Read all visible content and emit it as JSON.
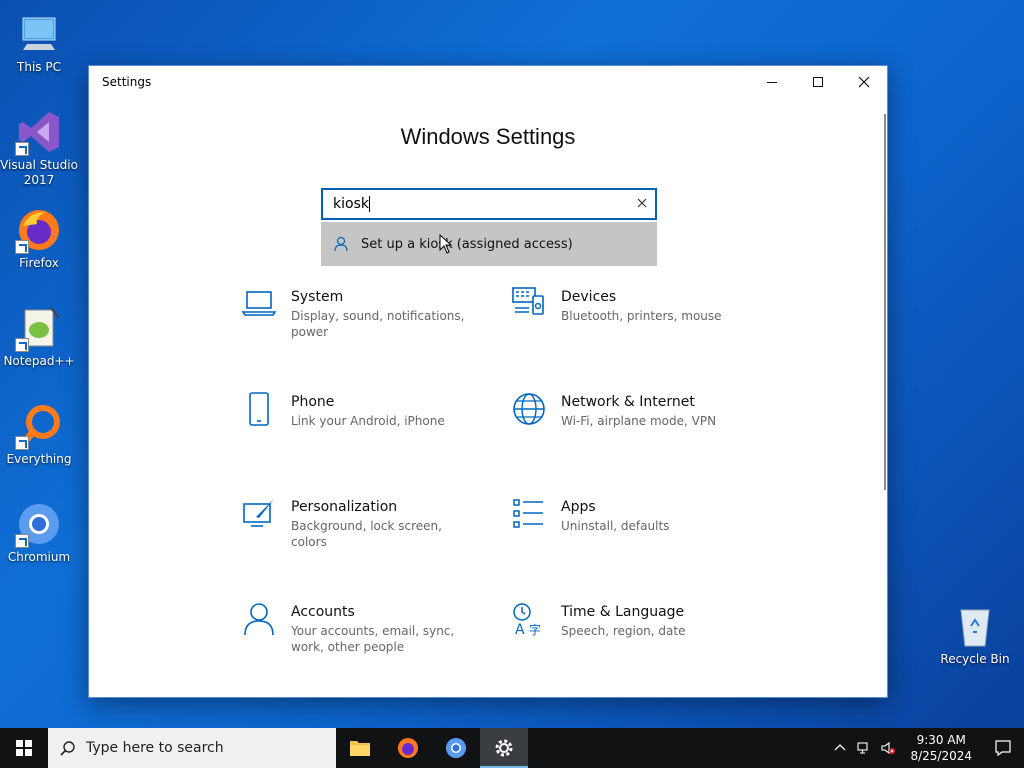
{
  "desktop": {
    "icons": [
      {
        "label": "This PC"
      },
      {
        "label": "Visual Studio 2017"
      },
      {
        "label": "Firefox"
      },
      {
        "label": "Notepad++"
      },
      {
        "label": "Everything"
      },
      {
        "label": "Chromium"
      },
      {
        "label": "Recycle Bin"
      }
    ]
  },
  "window": {
    "title": "Settings",
    "heading": "Windows Settings",
    "search": {
      "value": "kiosk",
      "suggestion": "Set up a kiosk (assigned access)"
    },
    "tiles": [
      {
        "title": "System",
        "desc": "Display, sound, notifications, power",
        "icon": "laptop-icon"
      },
      {
        "title": "Devices",
        "desc": "Bluetooth, printers, mouse",
        "icon": "devices-icon"
      },
      {
        "title": "Phone",
        "desc": "Link your Android, iPhone",
        "icon": "phone-icon"
      },
      {
        "title": "Network & Internet",
        "desc": "Wi-Fi, airplane mode, VPN",
        "icon": "globe-icon"
      },
      {
        "title": "Personalization",
        "desc": "Background, lock screen, colors",
        "icon": "paintbrush-icon"
      },
      {
        "title": "Apps",
        "desc": "Uninstall, defaults",
        "icon": "apps-list-icon"
      },
      {
        "title": "Accounts",
        "desc": "Your accounts, email, sync, work, other people",
        "icon": "person-icon"
      },
      {
        "title": "Time & Language",
        "desc": "Speech, region, date",
        "icon": "time-language-icon"
      }
    ]
  },
  "taskbar": {
    "search_placeholder": "Type here to search",
    "time": "9:30 AM",
    "date": "8/25/2024"
  },
  "colors": {
    "accent": "#0063b1",
    "icon_blue": "#0067c0"
  }
}
